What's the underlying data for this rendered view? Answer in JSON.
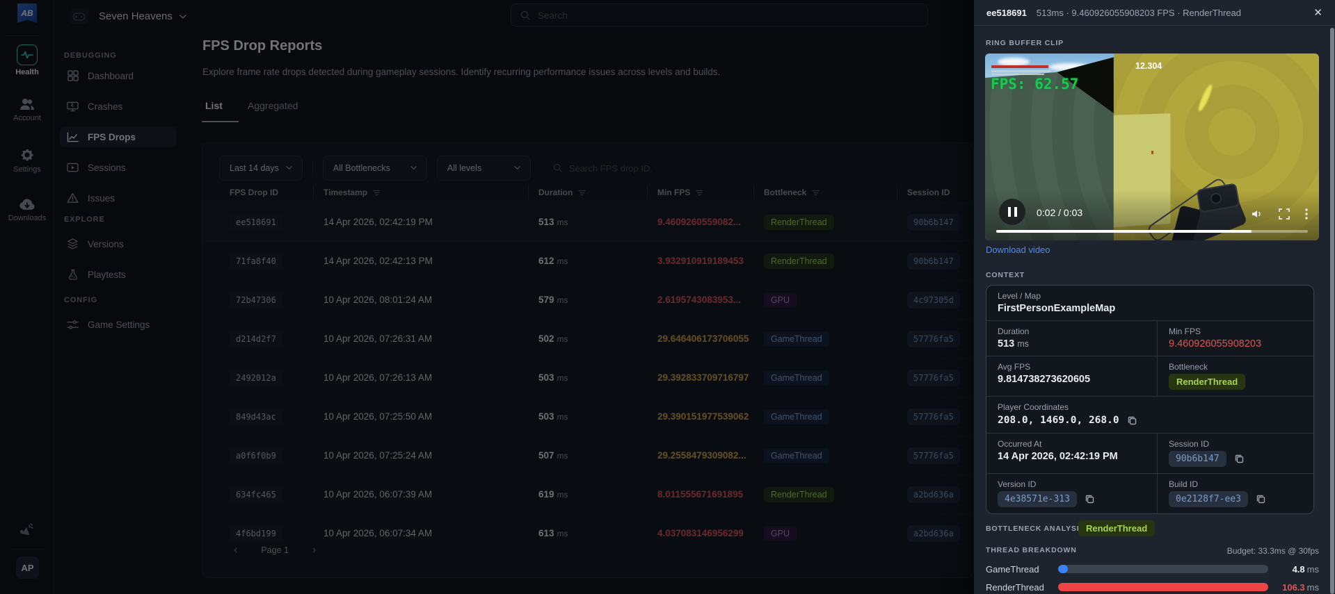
{
  "colors": {
    "accent_blue": "#3b82f6",
    "red": "#e25555",
    "amber": "#d1a23f",
    "teal": "#2fd4c0",
    "green_badge": "#a8d54f",
    "link_blue": "#4c8df0"
  },
  "topbar": {
    "logo_text": "AB",
    "project_name": "Seven Heavens",
    "search_placeholder": "Search"
  },
  "rail": {
    "items": [
      {
        "label": "Health",
        "icon": "health-icon",
        "active": true
      },
      {
        "label": "Account",
        "icon": "account-icon",
        "active": false
      },
      {
        "label": "Settings",
        "icon": "settings-icon",
        "active": false
      },
      {
        "label": "Downloads",
        "icon": "downloads-icon",
        "active": false
      }
    ],
    "avatar_initials": "AP"
  },
  "sidebar": {
    "sections": [
      {
        "label": "DEBUGGING",
        "items": [
          {
            "label": "Dashboard",
            "icon": "dashboard-icon",
            "active": false
          },
          {
            "label": "Crashes",
            "icon": "crashes-icon",
            "active": false
          },
          {
            "label": "FPS Drops",
            "icon": "fps-drops-icon",
            "active": true
          },
          {
            "label": "Sessions",
            "icon": "sessions-icon",
            "active": false
          },
          {
            "label": "Issues",
            "icon": "issues-icon",
            "active": false
          }
        ]
      },
      {
        "label": "EXPLORE",
        "items": [
          {
            "label": "Versions",
            "icon": "versions-icon",
            "active": false
          },
          {
            "label": "Playtests",
            "icon": "playtests-icon",
            "active": false
          }
        ]
      },
      {
        "label": "CONFIG",
        "items": [
          {
            "label": "Game Settings",
            "icon": "game-settings-icon",
            "active": false
          }
        ]
      }
    ]
  },
  "main": {
    "title": "FPS Drop Reports",
    "subtitle": "Explore frame rate drops detected during gameplay sessions. Identify recurring performance issues across levels and builds.",
    "tabs": [
      {
        "label": "List",
        "active": true
      },
      {
        "label": "Aggregated",
        "active": false
      }
    ],
    "filters": {
      "date_range": "Last 14 days",
      "bottleneck": "All Bottlenecks",
      "level": "All levels",
      "search_placeholder": "Search FPS drop ID."
    },
    "table": {
      "columns": [
        "FPS Drop ID",
        "Timestamp",
        "Duration",
        "Min FPS",
        "Bottleneck",
        "Session ID"
      ],
      "duration_unit": "ms",
      "rows": [
        {
          "id": "ee518691",
          "timestamp": "14 Apr 2026, 02:42:19 PM",
          "duration": "513",
          "min_fps": "9.4609260559082...",
          "fps_color": "red",
          "bottleneck": "RenderThread",
          "session": "90b6b147",
          "selected": true
        },
        {
          "id": "71fa8f40",
          "timestamp": "14 Apr 2026, 02:42:13 PM",
          "duration": "612",
          "min_fps": "3.932910919189453",
          "fps_color": "red",
          "bottleneck": "RenderThread",
          "session": "90b6b147",
          "selected": false
        },
        {
          "id": "72b47306",
          "timestamp": "10 Apr 2026, 08:01:24 AM",
          "duration": "579",
          "min_fps": "2.6195743083953...",
          "fps_color": "red",
          "bottleneck": "GPU",
          "session": "4c97305d",
          "selected": false
        },
        {
          "id": "d214d2f7",
          "timestamp": "10 Apr 2026, 07:26:31 AM",
          "duration": "502",
          "min_fps": "29.646406173706055",
          "fps_color": "amber",
          "bottleneck": "GameThread",
          "session": "57776fa5",
          "selected": false
        },
        {
          "id": "2492012a",
          "timestamp": "10 Apr 2026, 07:26:13 AM",
          "duration": "503",
          "min_fps": "29.392833709716797",
          "fps_color": "amber",
          "bottleneck": "GameThread",
          "session": "57776fa5",
          "selected": false
        },
        {
          "id": "849d43ac",
          "timestamp": "10 Apr 2026, 07:25:50 AM",
          "duration": "503",
          "min_fps": "29.390151977539062",
          "fps_color": "amber",
          "bottleneck": "GameThread",
          "session": "57776fa5",
          "selected": false
        },
        {
          "id": "a0f6f0b9",
          "timestamp": "10 Apr 2026, 07:25:24 AM",
          "duration": "507",
          "min_fps": "29.2558479309082...",
          "fps_color": "amber",
          "bottleneck": "GameThread",
          "session": "57776fa5",
          "selected": false
        },
        {
          "id": "634fc465",
          "timestamp": "10 Apr 2026, 06:07:39 AM",
          "duration": "619",
          "min_fps": "8.011555671691895",
          "fps_color": "red",
          "bottleneck": "RenderThread",
          "session": "a2bd636a",
          "selected": false
        },
        {
          "id": "4f6bd199",
          "timestamp": "10 Apr 2026, 06:07:34 AM",
          "duration": "613",
          "min_fps": "4.037083146956299",
          "fps_color": "red",
          "bottleneck": "GPU",
          "session": "a2bd636a",
          "selected": false
        }
      ],
      "pagination": {
        "label": "Page 1"
      }
    }
  },
  "panel": {
    "id": "ee518691",
    "meta": "513ms · 9.460926055908203 FPS · RenderThread",
    "clip_label": "RING BUFFER CLIP",
    "video": {
      "fps_overlay": "FPS: 62.57",
      "stat_overlay": "12.304",
      "time": "0:02 / 0:03",
      "progress_pct": 82,
      "download_label": "Download video"
    },
    "context_label": "CONTEXT",
    "context": {
      "level_map_label": "Level / Map",
      "level_map": "FirstPersonExampleMap",
      "duration_label": "Duration",
      "duration_value": "513",
      "duration_unit": "ms",
      "min_fps_label": "Min FPS",
      "min_fps": "9.460926055908203",
      "avg_fps_label": "Avg FPS",
      "avg_fps": "9.814738273620605",
      "bottleneck_label": "Bottleneck",
      "bottleneck": "RenderThread",
      "coords_label": "Player Coordinates",
      "coords": "208.0, 1469.0, 268.0",
      "occurred_label": "Occurred At",
      "occurred": "14 Apr 2026, 02:42:19 PM",
      "session_label": "Session ID",
      "session": "90b6b147",
      "version_label": "Version ID",
      "version": "4e38571e-313",
      "build_label": "Build ID",
      "build": "0e2128f7-ee3"
    },
    "bottleneck_analysis_label": "BOTTLENECK ANALYSIS",
    "bottleneck_badge": "RenderThread",
    "thread_breakdown": {
      "label": "THREAD BREAKDOWN",
      "budget": "Budget: 33.3ms @ 30fps",
      "threads": [
        {
          "name": "GameThread",
          "value": "4.8",
          "unit": "ms",
          "fill_pct": 4.5,
          "color": "blue",
          "value_color": "white"
        },
        {
          "name": "RenderThread",
          "value": "106.3",
          "unit": "ms",
          "fill_pct": 100,
          "color": "red",
          "value_color": "red"
        }
      ]
    }
  }
}
